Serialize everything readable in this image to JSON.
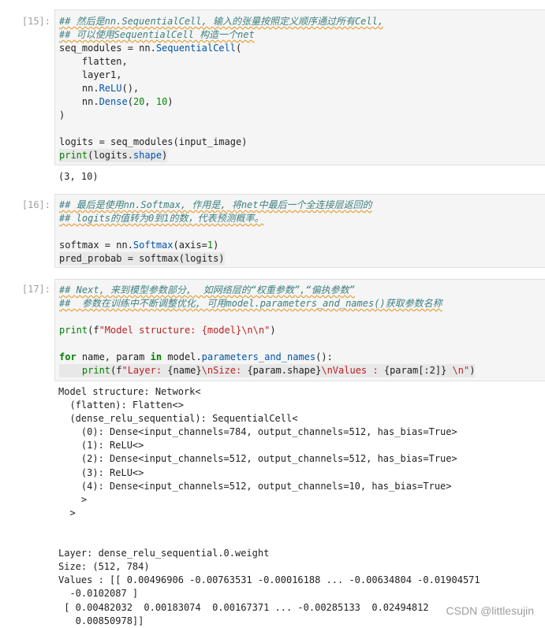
{
  "cells": [
    {
      "prompt": "[15]:",
      "code": {
        "l1": "## 然后是nn.SequentialCell, 输入的张量按照定义顺序通过所有Cell,",
        "l2": "## 可以使用SequentialCell 构造一个net",
        "l3a": "seq_modules = nn.",
        "l3b": "SequentialCell",
        "l3c": "(",
        "l4": "    flatten,",
        "l5": "    layer1,",
        "l6a": "    nn.",
        "l6b": "ReLU",
        "l6c": "(),",
        "l7a": "    nn.",
        "l7b": "Dense",
        "l7c": "(",
        "l7d": "20",
        "l7e": ", ",
        "l7f": "10",
        "l7g": ")",
        "l8": ")",
        "l9": "logits = seq_modules(input_image)",
        "l10a": "print",
        "l10b": "(logits.",
        "l10c": "shape",
        "l10d": ")"
      },
      "output": "(3, 10)"
    },
    {
      "prompt": "[16]:",
      "code": {
        "l1": "## 最后是使用nn.Softmax, 作用是, 将net中最后一个全连接层返回的",
        "l2": "## logits的值转为0到1的数，代表预测概率。",
        "l3a": "softmax = nn.",
        "l3b": "Softmax",
        "l3c": "(axis=",
        "l3d": "1",
        "l3e": ")",
        "l4": "pred_probab = softmax(logits)"
      }
    },
    {
      "prompt": "[17]:",
      "code": {
        "l1": "## Next, 来到模型参数部分,  如网络层的“权重参数”,“偏执参数”",
        "l2": "##  参数在训练中不断调整优化, 可用model.parameters_and_names()获取参数名称",
        "l3a": "print",
        "l3b": "(f",
        "l3c": "\"Model structure: {model}\\n\\n\"",
        "l3d": ")",
        "l4a": "for",
        "l4b": " name, param ",
        "l4c": "in",
        "l4d": " model.",
        "l4e": "parameters_and_names",
        "l4f": "():",
        "l5a": "    ",
        "l5b": "print",
        "l5c": "(f",
        "l5d": "\"Layer: ",
        "l5e": "{name}",
        "l5f": "\\nSize: ",
        "l5g": "{param.shape}",
        "l5h": "\\nValues : ",
        "l5i": "{param[:2]}",
        "l5j": " \\n\"",
        "l5k": ")"
      },
      "output": "Model structure: Network<\n  (flatten): Flatten<>\n  (dense_relu_sequential): SequentialCell<\n    (0): Dense<input_channels=784, output_channels=512, has_bias=True>\n    (1): ReLU<>\n    (2): Dense<input_channels=512, output_channels=512, has_bias=True>\n    (3): ReLU<>\n    (4): Dense<input_channels=512, output_channels=10, has_bias=True>\n    >\n  >\n\n\nLayer: dense_relu_sequential.0.weight\nSize: (512, 784)\nValues : [[ 0.00496906 -0.00763531 -0.00016188 ... -0.00634804 -0.01904571\n  -0.0102087 ]\n [ 0.00482032  0.00183074  0.00167371 ... -0.00285133  0.02494812\n   0.00850978]]"
    }
  ],
  "watermark": "CSDN @littlesujin"
}
